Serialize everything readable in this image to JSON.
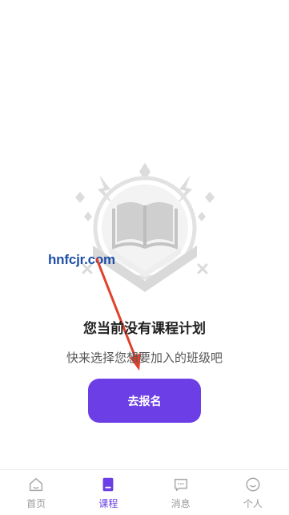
{
  "empty_state": {
    "title": "您当前没有课程计划",
    "subtitle": "快来选择您想要加入的班级吧",
    "enroll_button": "去报名",
    "watermark": "hnfcjr.com"
  },
  "tabbar": {
    "tabs": [
      {
        "label": "首页",
        "icon": "home-icon",
        "active": false
      },
      {
        "label": "课程",
        "icon": "course-icon",
        "active": true
      },
      {
        "label": "消息",
        "icon": "message-icon",
        "active": false
      },
      {
        "label": "个人",
        "icon": "profile-icon",
        "active": false
      }
    ]
  },
  "colors": {
    "accent": "#6b3ee6",
    "inactive": "#9a9a9a",
    "illustration": "#d8d8d8",
    "arrow": "#e0412c",
    "watermark": "#1f4fa8"
  }
}
